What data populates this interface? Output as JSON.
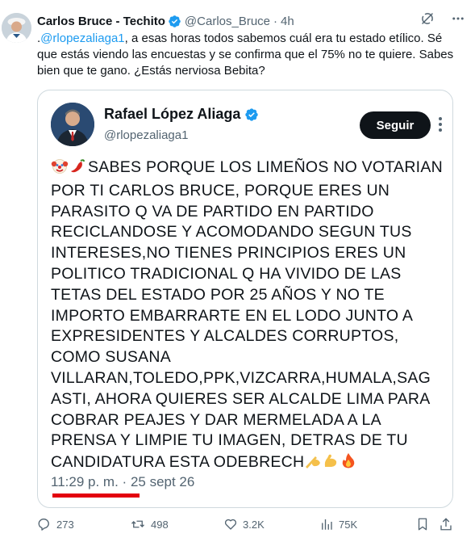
{
  "tweet": {
    "author_name": "Carlos Bruce - Techito",
    "handle": "@Carlos_Bruce",
    "separator": "·",
    "time": "4h",
    "text_prefix": ".",
    "mention": "@rlopezaliaga1",
    "text_rest": ", a esas horas todos sabemos cuál era tu estado etílico. Sé que estás viendo las encuestas y se confirma que el 75% no te quiere. Sabes bien que te gano. ¿Estás nerviosa Bebita?"
  },
  "quoted": {
    "name": "Rafael López Aliaga",
    "handle": "@rlopezaliaga1",
    "follow_label": "Seguir",
    "text": "SABES PORQUE LOS LIMEÑOS NO VOTARIAN POR TI CARLOS BRUCE, PORQUE ERES UN PARASITO Q VA DE PARTIDO EN PARTIDO RECICLANDOSE Y ACOMODANDO  SEGUN TUS INTERESES,NO TIENES  PRINCIPIOS ERES UN POLITICO TRADICIONAL Q HA VIVIDO DE LAS TETAS DEL ESTADO POR 25 AÑOS Y NO TE IMPORTO EMBARRARTE EN EL LODO JUNTO A EXPRESIDENTES Y ALCALDES CORRUPTOS, COMO SUSANA VILLARAN,TOLEDO,PPK,VIZCARRA,HUMALA,SAG ASTI, AHORA QUIERES SER ALCALDE LIMA PARA COBRAR PEAJES Y DAR MERMELADA A LA PRENSA Y LIMPIE TU IMAGEN, DETRAS DE TU CANDIDATURA ESTA ODEBRECH",
    "leading_emojis": [
      "clown-emoji",
      "chili-pepper-emoji"
    ],
    "trailing_emojis": [
      "writing-hand-emoji",
      "flexed-biceps-emoji",
      "fire-emoji"
    ],
    "time": "11:29 p. m.",
    "separator": "·",
    "date": "25 sept 26"
  },
  "actions": {
    "replies": "273",
    "reposts": "498",
    "likes": "3.2K",
    "views": "75K"
  },
  "icons": {
    "verified": "verified-badge-icon",
    "grok": "grok-icon",
    "more": "more-icon",
    "reply": "reply-icon",
    "repost": "repost-icon",
    "like": "heart-icon",
    "views": "views-icon",
    "bookmark": "bookmark-icon",
    "share": "share-icon"
  },
  "colors": {
    "link": "#1d9bf0",
    "verified": "#1d9bf0",
    "muted": "#536471",
    "highlight_mark": "#e3000f",
    "follow_button": "#0f1419"
  }
}
